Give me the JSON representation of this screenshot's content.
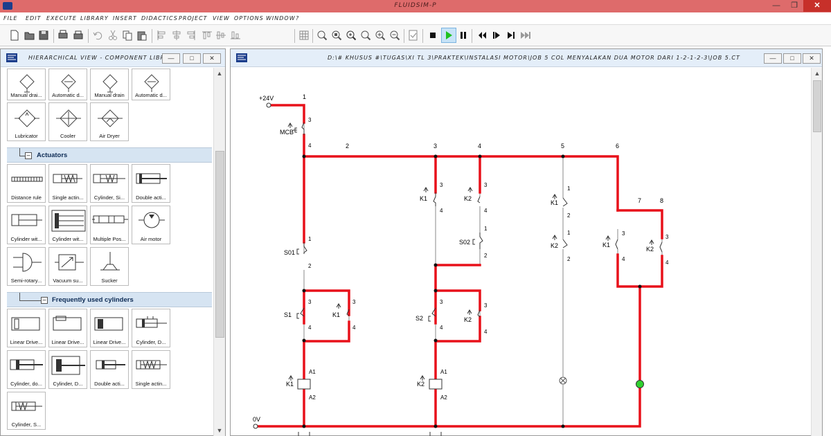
{
  "window": {
    "title": "FLUIDSIM-P",
    "min_icon": "minimize-icon",
    "max_icon": "maximize-icon",
    "close_icon": "close-icon"
  },
  "menu": [
    "FILE",
    "EDIT",
    "EXECUTE",
    "LIBRARY",
    "INSERT",
    "DIDACTICS",
    "PROJECT",
    "VIEW",
    "OPTIONS",
    "WINDOW",
    "?"
  ],
  "toolbar": [
    "new-icon",
    "open-icon",
    "save-icon",
    "print-preview-icon",
    "print-icon",
    "undo-icon",
    "cut-icon",
    "copy-icon",
    "paste-icon",
    "align-left-icon",
    "align-center-icon",
    "align-right-icon",
    "align-top-icon",
    "align-middle-icon",
    "align-bottom-icon",
    "grid-icon",
    "zoom-fit-icon",
    "zoom-all-icon",
    "zoom-window-icon",
    "zoom-page-icon",
    "zoom-in-icon",
    "zoom-out-icon",
    "check-icon",
    "stop-icon",
    "play-icon",
    "pause-icon",
    "reset-icon",
    "step-icon",
    "single-step-icon",
    "until-end-icon"
  ],
  "library": {
    "title": "HIERARCHICAL VIEW - COMPONENT LIBRARY",
    "row1": [
      "Manual drai...",
      "Automatic d...",
      "Manual drain",
      "Automatic d..."
    ],
    "row2": [
      "Lubricator",
      "Cooler",
      "Air Dryer"
    ],
    "cat_actuators": "Actuators",
    "actuators": [
      "Distance rule",
      "Single actin...",
      "Cylinder, Si...",
      "Double acti...",
      "Cylinder wit...",
      "Cylinder wit...",
      "Multiple Pos...",
      "Air motor",
      "Semi-rotary...",
      "Vacuum su...",
      "Sucker"
    ],
    "cat_cylinders": "Frequently used cylinders",
    "cylinders": [
      "Linear Drive...",
      "Linear Drive...",
      "Linear Drive...",
      "Cylinder, D...",
      "Cylinder, do...",
      "Cylinder, D...",
      "Double acti...",
      "Single actin...",
      "Cylinder, S..."
    ]
  },
  "circuit": {
    "path": "D:\\# KHUSUS #\\TUGAS\\XI TL 3\\PRAKTEK\\INSTALASI MOTOR\\JOB 5 COL MENYALAKAN DUA MOTOR DARI 1-2-1-2-3\\JOB 5.CT",
    "supply_pos": "+24V",
    "supply_neg": "0V",
    "col_nums": [
      "1",
      "2",
      "3",
      "4",
      "5",
      "6",
      "7",
      "8"
    ],
    "mcb": "MCB",
    "s01": "S01",
    "s02": "S02",
    "s1": "S1",
    "s2": "S2",
    "k1": "K1",
    "k2": "K2",
    "t1": "1",
    "t2": "2",
    "t3": "3",
    "t4": "4",
    "a1": "A1",
    "a2": "A2"
  },
  "colors": {
    "wire_active": "#e8111a",
    "wire_inactive": "#8a8a8a",
    "lamp_on": "#2fd12f",
    "title_bar": "#de6b6b"
  }
}
